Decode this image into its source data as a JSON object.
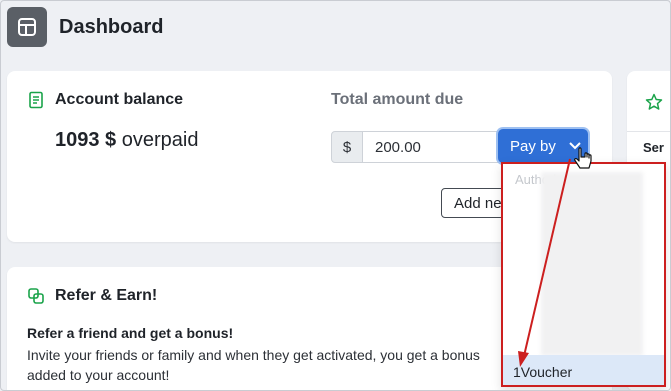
{
  "header": {
    "title": "Dashboard",
    "icon": "dashboard-layout-icon"
  },
  "balance_card": {
    "title": "Account balance",
    "icon": "ledger-icon",
    "amount": "1093 $",
    "status": "overpaid",
    "total_label": "Total amount due",
    "currency_symbol": "$",
    "amount_value": "200.00",
    "pay_button_label": "Pay by",
    "add_button_label": "Add new"
  },
  "refer_card": {
    "title": "Refer & Earn!",
    "icon": "refer-link-icon",
    "headline": "Refer a friend and get a bonus!",
    "body": "Invite your friends or family and when they get activated, you get a bonus added to your account!"
  },
  "right_card": {
    "icon": "star-icon",
    "column_header": "Ser"
  },
  "pay_dropdown": {
    "first_option_partial": "Authori",
    "selected_option": "1Voucher"
  },
  "colors": {
    "accent": "#2f6fd6",
    "annotation_red": "#cc1f1f",
    "green_icon": "#1aa34a",
    "header_icon_bg": "#5a5f66"
  }
}
